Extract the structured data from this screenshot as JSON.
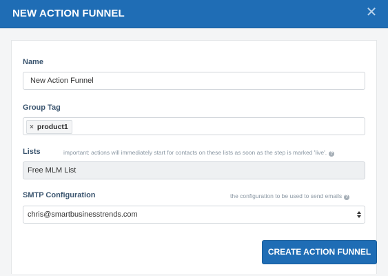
{
  "header": {
    "title": "NEW ACTION FUNNEL",
    "close_label": "✕"
  },
  "form": {
    "name": {
      "label": "Name",
      "value": "New Action Funnel"
    },
    "group_tag": {
      "label": "Group Tag",
      "tags": [
        "product1"
      ],
      "remove_symbol": "×"
    },
    "lists": {
      "label": "Lists",
      "hint": "important: actions will immediately start for contacts on these lists as soon as the step is marked 'live'.",
      "value": "Free MLM List"
    },
    "smtp": {
      "label": "SMTP Configuration",
      "hint": "the configuration to be used to send emails",
      "value": "chris@smartbusinesstrends.com"
    }
  },
  "help_icon_glyph": "?",
  "actions": {
    "create_label": "CREATE ACTION FUNNEL"
  },
  "colors": {
    "accent": "#1f6db5",
    "label": "#3c5670"
  }
}
